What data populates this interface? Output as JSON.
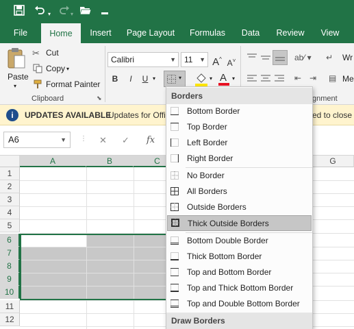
{
  "quick_access": {
    "save_icon": "save-icon",
    "undo_icon": "undo-icon",
    "redo_icon": "redo-icon",
    "open_icon": "folder-open-icon",
    "customize_icon": "customize-qat-icon"
  },
  "tabs": [
    "File",
    "Home",
    "Insert",
    "Page Layout",
    "Formulas",
    "Data",
    "Review",
    "View"
  ],
  "ribbon": {
    "clipboard": {
      "paste_label": "Paste",
      "cut_label": "Cut",
      "copy_label": "Copy",
      "format_painter_label": "Format Painter",
      "group_label": "Clipboard"
    },
    "font": {
      "font_name": "Calibri",
      "font_size": "11",
      "bold": "B",
      "italic": "I",
      "underline": "U",
      "group_label_partial": "F"
    },
    "alignment": {
      "wrap_partial": "Wr",
      "merge_partial": "Me",
      "group_label_partial": "gnment"
    }
  },
  "update_bar": {
    "title": "UPDATES AVAILABLE",
    "message_left": "Updates for Offi",
    "message_right": "ed to close s"
  },
  "formula_bar": {
    "name_box": "A6",
    "fx": "fx"
  },
  "grid": {
    "columns": [
      "A",
      "B",
      "C",
      "G"
    ],
    "rows": [
      "1",
      "2",
      "3",
      "4",
      "5",
      "6",
      "7",
      "8",
      "9",
      "10",
      "11",
      "12"
    ]
  },
  "borders_menu": {
    "heading": "Borders",
    "items": [
      {
        "label": "Bottom Border",
        "icon": "bottom-border-icon"
      },
      {
        "label": "Top Border",
        "icon": "top-border-icon"
      },
      {
        "label": "Left Border",
        "icon": "left-border-icon"
      },
      {
        "label": "Right Border",
        "icon": "right-border-icon"
      },
      {
        "label": "No Border",
        "icon": "no-border-icon"
      },
      {
        "label": "All Borders",
        "icon": "all-borders-icon"
      },
      {
        "label": "Outside Borders",
        "icon": "outside-borders-icon"
      },
      {
        "label": "Thick Outside Borders",
        "icon": "thick-outside-borders-icon"
      },
      {
        "label": "Bottom Double Border",
        "icon": "bottom-double-border-icon"
      },
      {
        "label": "Thick Bottom Border",
        "icon": "thick-bottom-border-icon"
      },
      {
        "label": "Top and Bottom Border",
        "icon": "top-bottom-border-icon"
      },
      {
        "label": "Top and Thick Bottom Border",
        "icon": "top-thick-bottom-border-icon"
      },
      {
        "label": "Top and Double Bottom Border",
        "icon": "top-double-bottom-border-icon"
      }
    ],
    "draw_heading": "Draw Borders"
  },
  "colors": {
    "excel_green": "#217346",
    "update_bar": "#fff4ce",
    "selection_gray": "#c8c8c8",
    "font_color_red": "#e81123",
    "highlight_yellow": "#ffe600"
  }
}
